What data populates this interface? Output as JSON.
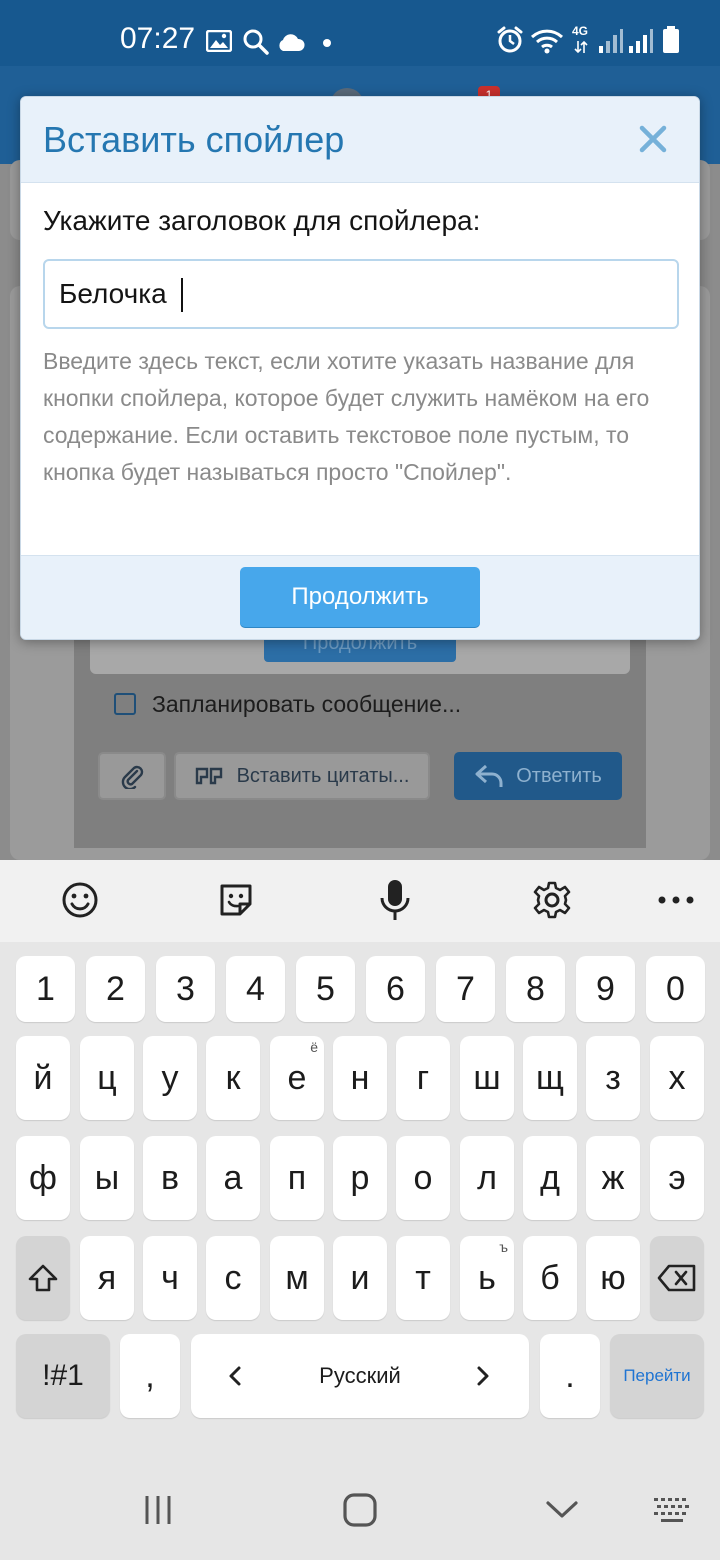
{
  "status_bar": {
    "time": "07:27",
    "network_type": "4G",
    "icons": [
      "gallery-icon",
      "search-icon",
      "cloud-icon",
      "dot-icon",
      "alarm-icon",
      "wifi-icon",
      "signal-icon",
      "signal-icon",
      "battery-icon"
    ]
  },
  "background": {
    "inner_continue_label": "Продолжить",
    "schedule_label": "Запланировать сообщение...",
    "insert_quotes_label": "Вставить цитаты...",
    "reply_label": "Ответить",
    "badge_count": "1"
  },
  "dialog": {
    "title": "Вставить спойлер",
    "field_label": "Укажите заголовок для спойлера:",
    "input_value": "Белочка",
    "hint": "Введите здесь текст, если хотите указать название для кнопки спойлера, которое будет служить намёком на его содержание. Если оставить текстовое поле пустым, то кнопка будет называться просто \"Спойлер\".",
    "continue_label": "Продолжить"
  },
  "keyboard": {
    "digits": [
      "1",
      "2",
      "3",
      "4",
      "5",
      "6",
      "7",
      "8",
      "9",
      "0"
    ],
    "row1": [
      "й",
      "ц",
      "у",
      "к",
      "е",
      "н",
      "г",
      "ш",
      "щ",
      "з",
      "х"
    ],
    "row1_alt_e": "ё",
    "row2": [
      "ф",
      "ы",
      "в",
      "а",
      "п",
      "р",
      "о",
      "л",
      "д",
      "ж",
      "э"
    ],
    "row3": [
      "я",
      "ч",
      "с",
      "м",
      "и",
      "т",
      "ь",
      "б",
      "ю"
    ],
    "row3_alt_soft": "ъ",
    "symbols_label": "!#1",
    "comma_label": ",",
    "space_label": "Русский",
    "period_label": ".",
    "go_label": "Перейти"
  },
  "colors": {
    "status_bar": "#17588f",
    "dialog_title": "#2577b1",
    "primary_button": "#47a7eb",
    "header_bg": "#e8f1fa"
  }
}
